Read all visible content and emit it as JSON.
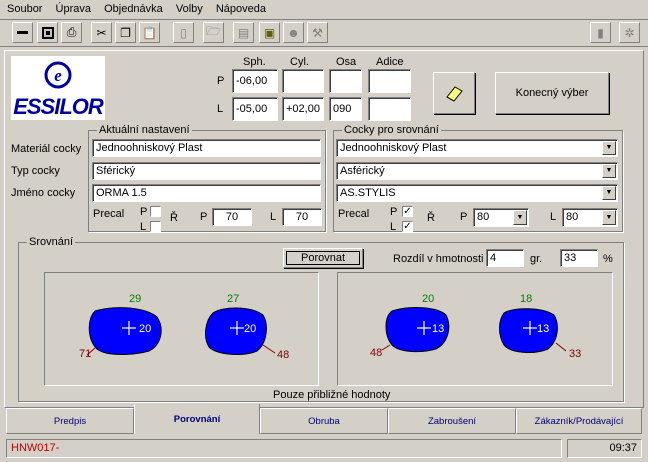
{
  "menu": [
    "Soubor",
    "Úprava",
    "Objednávka",
    "Volby",
    "Nápoveda"
  ],
  "logo": {
    "text": "ESSILOR"
  },
  "rx": {
    "headers": [
      "Sph.",
      "Cyl.",
      "Osa",
      "Adice"
    ],
    "P": {
      "label": "P",
      "sph": "-06,00",
      "cyl": "",
      "osa": "",
      "adice": ""
    },
    "L": {
      "label": "L",
      "sph": "-05,00",
      "cyl": "+02,00",
      "osa": "090",
      "adice": ""
    }
  },
  "final_button": "Konecný výber",
  "current": {
    "title": "Aktuální nastavení",
    "material_label": "Materiál cocky",
    "material": "Jednoohniskový Plast",
    "type_label": "Typ cocky",
    "type": "Sférický",
    "name_label": "Jméno cocky",
    "name": "ORMA 1.5",
    "precal_label": "Precal",
    "p_label": "P",
    "l_label": "L",
    "r_label": "Ř",
    "p_val": "70",
    "l_val": "70"
  },
  "compare": {
    "title": "Cocky pro srovnání",
    "material": "Jednoohniskový Plast",
    "type": "Asférický",
    "name": "AS.STYLIS",
    "precal_label": "Precal",
    "p_label": "P",
    "l_label": "L",
    "r_label": "Ř",
    "p_val": "80",
    "l_val": "80",
    "p_checked": "✓",
    "l_checked": "✓"
  },
  "srovnani": {
    "title": "Srovnání",
    "button": "Porovnat",
    "weight_label": "Rozdíl v hmotnosti",
    "weight_val": "4",
    "weight_unit": "gr.",
    "pct_val": "33",
    "pct_unit": "%",
    "note": "Pouze přibližné hodnoty"
  },
  "lenses": {
    "left_pair": {
      "r_top": "29",
      "r_center": "20",
      "r_bottom": "71",
      "l_top": "27",
      "l_center": "20",
      "l_bottom": "48"
    },
    "right_pair": {
      "r_top": "20",
      "r_center": "13",
      "r_bottom": "48",
      "l_top": "18",
      "l_center": "13",
      "l_bottom": "33"
    }
  },
  "tabs": [
    "Predpis",
    "Porovnání",
    "Obruba",
    "Zabroušení",
    "Zákazník/Prodávající"
  ],
  "status": {
    "left": "HNW017-",
    "time": "09:37"
  },
  "colors": {
    "lens": "#0000ff",
    "top_num": "#008000",
    "bottom_num": "#800000",
    "tab_text": "#00007b"
  }
}
